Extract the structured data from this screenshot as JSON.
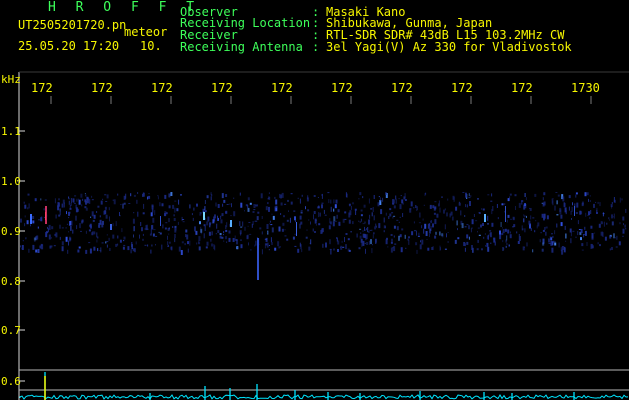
{
  "header": {
    "title": "H R O F F T",
    "filename": "UT2505201720.pn",
    "tag": "meteor",
    "datetime": "25.05.20 17:20",
    "count": "10.",
    "info": [
      {
        "label": "Observer",
        "value": "Masaki Kano"
      },
      {
        "label": "Receiving Location",
        "value": "Shibukawa, Gunma, Japan"
      },
      {
        "label": "Receiver",
        "value": "RTL-SDR SDR# 43dB L15 103.2MHz CW"
      },
      {
        "label": "Receiving Antenna",
        "value": "3el Yagi(V) Az 330 for Vladivostok"
      }
    ],
    "separator": ":"
  },
  "axes": {
    "y_unit": "kHz",
    "y_ticks": [
      "1.1",
      "1.0",
      "0.9",
      "0.8",
      "0.7",
      "0.6"
    ],
    "x_ticks": [
      "172",
      "172",
      "172",
      "172",
      "172",
      "172",
      "172",
      "172",
      "172",
      "1730"
    ]
  },
  "colors": {
    "label": "#3dff5a",
    "text": "#f7f700",
    "trace": "#00e5ff",
    "echo": "#3a5cff"
  }
}
